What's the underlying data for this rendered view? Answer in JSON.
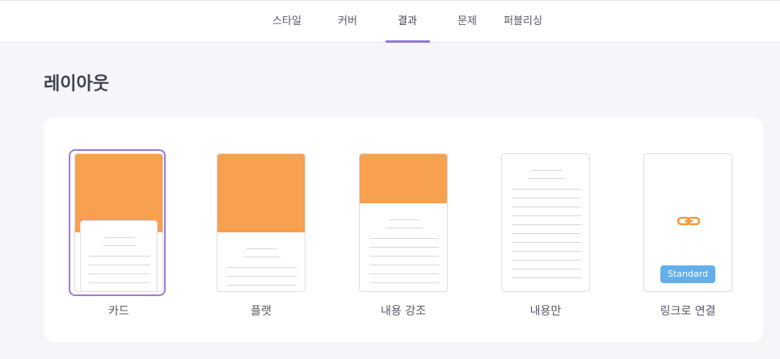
{
  "tabs": [
    {
      "label": "스타일"
    },
    {
      "label": "커버"
    },
    {
      "label": "결과",
      "active": true
    },
    {
      "label": "문제"
    },
    {
      "label": "퍼블리싱"
    }
  ],
  "page": {
    "title": "레이아웃"
  },
  "layouts": [
    {
      "label": "카드",
      "selected": true
    },
    {
      "label": "플랫"
    },
    {
      "label": "내용 강조"
    },
    {
      "label": "내용만"
    },
    {
      "label": "링크로 연결",
      "badge": "Standard",
      "icon": "link-icon"
    }
  ],
  "colors": {
    "accent": "#9575d8",
    "cover_orange": "#f7a050",
    "badge_blue": "#64aeeb",
    "link_icon_orange": "#f29a3f"
  }
}
